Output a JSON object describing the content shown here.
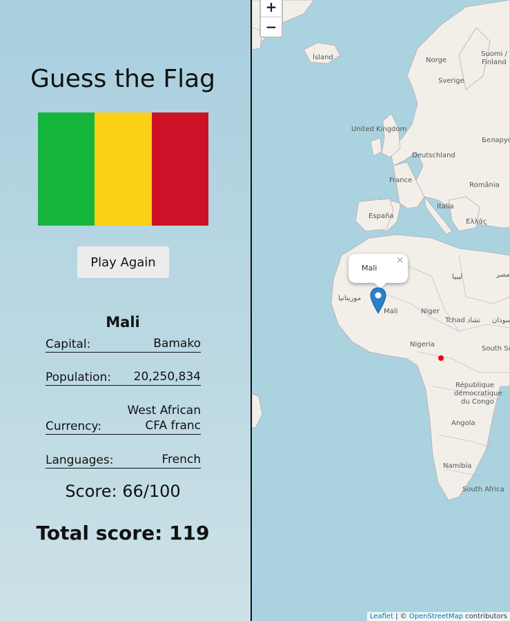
{
  "title": "Guess the Flag",
  "flag": {
    "country": "Mali",
    "colors": [
      "#14b53a",
      "#fcd116",
      "#ce1126"
    ]
  },
  "play_again_label": "Play Again",
  "country_name": "Mali",
  "info": {
    "capital_label": "Capital:",
    "capital": "Bamako",
    "population_label": "Population:",
    "population": "20,250,834",
    "currency_label": "Currency:",
    "currency_line1": "West African",
    "currency_line2": "CFA franc",
    "languages_label": "Languages:",
    "languages": "French"
  },
  "score": "Score: 66/100",
  "total_score": "Total score: 119",
  "map": {
    "zoom_in": "+",
    "zoom_out": "−",
    "popup_text": "Mali",
    "popup_close": "×",
    "labels": {
      "island": "Ísland",
      "norge": "Norge",
      "suomi": "Suomi /",
      "finland": "Finland",
      "sverige": "Sverige",
      "uk": "United Kingdom",
      "belarus": "Беларусь",
      "deutschland": "Deutschland",
      "france": "France",
      "romania": "România",
      "espana": "España",
      "italia": "Italia",
      "ellas": "Ελλάς",
      "libya": "ليبيا",
      "misr": "مصر",
      "mauritania": "موريتانيا",
      "mali": "Mali",
      "niger": "Niger",
      "tchad": "Tchad تشاد",
      "sudan": "السودان",
      "nigeria": "Nigeria",
      "south": "South Su",
      "rdc1": "République",
      "rdc2": "démocratique",
      "rdc3": "du Congo",
      "angola": "Angola",
      "namibia": "Namibia",
      "south_africa": "South Africa"
    },
    "attribution_leaflet": "Leaflet",
    "attribution_sep": " | © ",
    "attribution_osm": "OpenStreetMap",
    "attribution_suffix": " contributors"
  }
}
